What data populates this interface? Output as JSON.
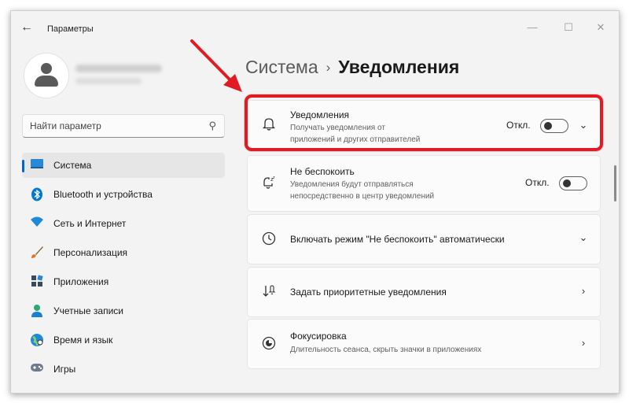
{
  "app": {
    "title": "Параметры"
  },
  "window_controls": {
    "minimize": "—",
    "maximize": "☐",
    "close": "✕"
  },
  "search": {
    "placeholder": "Найти параметр"
  },
  "nav": {
    "items": [
      {
        "label": "Система",
        "icon": "monitor-icon",
        "active": true
      },
      {
        "label": "Bluetooth и устройства",
        "icon": "bluetooth-icon"
      },
      {
        "label": "Сеть и Интернет",
        "icon": "wifi-icon"
      },
      {
        "label": "Персонализация",
        "icon": "brush-icon"
      },
      {
        "label": "Приложения",
        "icon": "apps-icon"
      },
      {
        "label": "Учетные записи",
        "icon": "account-icon"
      },
      {
        "label": "Время и язык",
        "icon": "globe-icon"
      },
      {
        "label": "Игры",
        "icon": "gamepad-icon"
      }
    ]
  },
  "breadcrumb": {
    "parent": "Система",
    "separator": "›",
    "current": "Уведомления"
  },
  "cards": [
    {
      "title": "Уведомления",
      "subtitle": "Получать уведомления от приложений и других отправителей",
      "status": "Откл.",
      "icon": "bell-icon"
    },
    {
      "title": "Не беспокоить",
      "subtitle": "Уведомления будут отправляться непосредственно в центр уведомлений",
      "status": "Откл.",
      "icon": "bell-sleep-icon"
    },
    {
      "title": "Включать режим \"Не беспокоить\" автоматически",
      "icon": "clock-icon"
    },
    {
      "title": "Задать приоритетные уведомления",
      "icon": "priority-icon"
    },
    {
      "title": "Фокусировка",
      "subtitle": "Длительность сеанса, скрыть значки в приложениях",
      "icon": "focus-icon"
    }
  ],
  "colors": {
    "accent": "#0067c0",
    "highlight": "#e01b24"
  }
}
